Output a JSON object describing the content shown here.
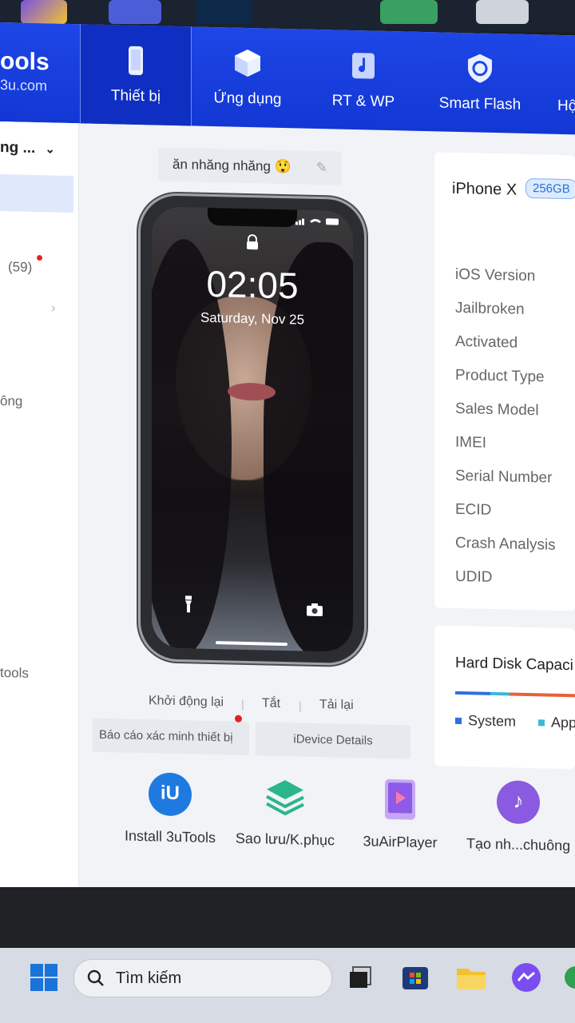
{
  "brand": {
    "name": "ools",
    "domain": "3u.com"
  },
  "nav": [
    {
      "label": "Thiết bị",
      "icon": "phone-icon"
    },
    {
      "label": "Ứng dụng",
      "icon": "cube-icon"
    },
    {
      "label": "RT & WP",
      "icon": "music-icon"
    },
    {
      "label": "Smart Flash",
      "icon": "refresh-shield-icon"
    },
    {
      "label": "Hộ",
      "icon": "toolbox-icon"
    }
  ],
  "sidebar": {
    "header": "ng ...",
    "count_label": "(59)",
    "item_ong": "ông",
    "item_tools": "tools"
  },
  "device": {
    "name": "ăn nhăng nhăng 😲",
    "model": "iPhone X",
    "capacity": "256GB",
    "lock_time": "02:05",
    "lock_date": "Saturday, Nov 25"
  },
  "phone_actions": [
    "Khởi động lại",
    "Tắt",
    "Tải lại"
  ],
  "report_button": "Báo cáo xác minh thiết bị",
  "details_button": "iDevice Details",
  "info_rows": [
    "iOS Version",
    "Jailbroken",
    "Activated",
    "Product Type",
    "Sales Model",
    "IMEI",
    "Serial Number",
    "ECID",
    "Crash Analysis",
    "UDID"
  ],
  "disk": {
    "title": "Hard Disk Capaci",
    "legend": [
      {
        "label": "System",
        "color": "#2f6fe0"
      },
      {
        "label": "App",
        "color": "#3ab8d8"
      }
    ]
  },
  "tools": [
    {
      "label": "Install 3uTools",
      "icon": "3utools-logo-icon",
      "color": "#1f7ae0"
    },
    {
      "label": "Sao lưu/K.phục",
      "icon": "layers-icon",
      "color": "#2bb58a"
    },
    {
      "label": "3uAirPlayer",
      "icon": "airplay-icon",
      "color": "#8e5ae8"
    },
    {
      "label": "Tạo nh...chuông",
      "icon": "ringtone-icon",
      "color": "#8a5ae0"
    }
  ],
  "taskbar": {
    "search_placeholder": "Tìm kiếm"
  },
  "colors": {
    "accent": "#1e46e6",
    "badge": "#2a6fd6",
    "alert": "#e32222"
  }
}
